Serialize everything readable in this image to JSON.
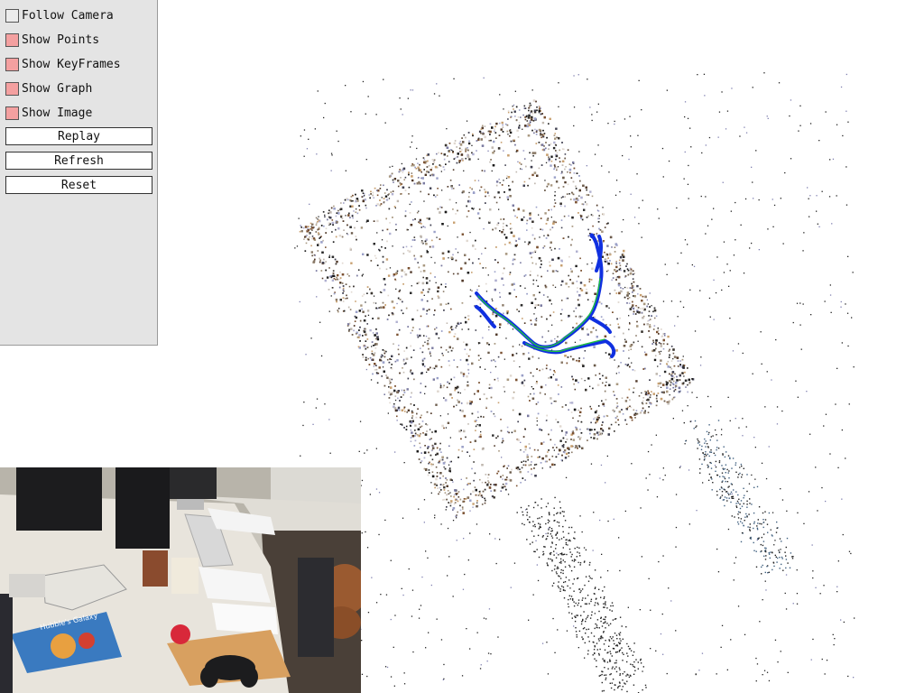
{
  "panel": {
    "checkboxes": [
      {
        "label": "Follow Camera",
        "checked": false
      },
      {
        "label": "Show Points",
        "checked": true
      },
      {
        "label": "Show KeyFrames",
        "checked": true
      },
      {
        "label": "Show Graph",
        "checked": true
      },
      {
        "label": "Show Image",
        "checked": true
      }
    ],
    "buttons": {
      "replay": "Replay",
      "refresh": "Refresh",
      "reset": "Reset"
    }
  },
  "colors": {
    "checked_box": "#f4a0a0",
    "unchecked_box": "#ececec",
    "trajectory_blue": "#1030e0",
    "trajectory_green": "#20c040",
    "panel_bg": "#e4e4e4"
  },
  "viewer": {
    "content": "3D point cloud reconstruction with keyframe trajectory"
  },
  "image_panel": {
    "book_title": "Hubble's Galaxy"
  }
}
